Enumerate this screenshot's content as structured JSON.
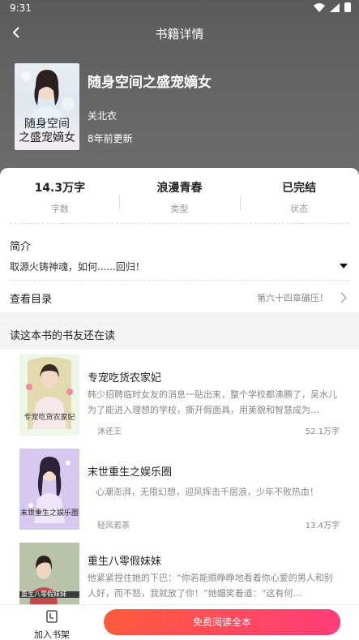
{
  "status_bar": {
    "time": "9:31"
  },
  "nav": {
    "title": "书籍详情"
  },
  "book": {
    "title": "随身空间之盛宠嫡女",
    "cover_text": "随身空间之盛宠嫡女",
    "author": "关北衣",
    "updated": "8年前更新",
    "stats": [
      {
        "value": "14.3万字",
        "label": "字数"
      },
      {
        "value": "浪漫青春",
        "label": "类型"
      },
      {
        "value": "已完结",
        "label": "状态"
      }
    ],
    "intro_label": "简介",
    "intro_text": "取源火铸神魂，如何......回归！",
    "toc_label": "查看目录",
    "toc_latest": "第六十四章碾压！"
  },
  "recommend": {
    "heading": "读这本书的书友还在读",
    "items": [
      {
        "title": "专宠吃货农家妃",
        "desc": "韩少招聘临时女友的消息一贴出来，整个学校都沸腾了，吴水儿为了能进入理想的学校，撕开假面具，用美貌和智慧成为…",
        "author": "沐还王",
        "words": "52.1万字",
        "cover_text": "专宠吃货农家妃"
      },
      {
        "title": "末世重生之娱乐圈",
        "desc": "心潮澎湃，无限幻想，迎风挥击千层浪，少年不败热血！",
        "author": "轻风若茶",
        "words": "13.4万字",
        "cover_text": "末世重生之娱乐圈"
      },
      {
        "title": "重生八零假妹妹",
        "desc": "他紧紧捏住她的下巴：“你若能眼睁睁地看着你心爱的男人和别人好，而不怒，我就放了你！”她媚笑着道：“这有何…",
        "author": "",
        "words": "",
        "cover_text": "重生八零假妹妹"
      }
    ]
  },
  "bottom": {
    "shelf_label": "加入书架",
    "read_label": "免费阅读全本"
  }
}
